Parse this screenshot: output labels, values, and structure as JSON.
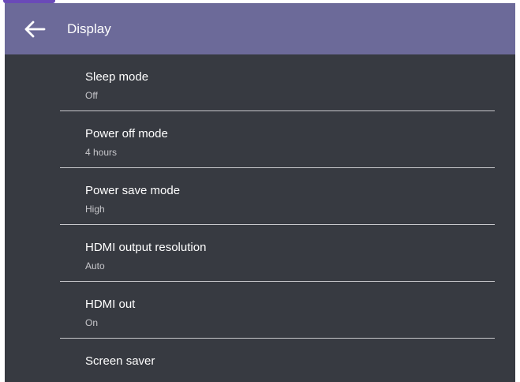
{
  "header": {
    "back_icon": "arrow-left-icon",
    "title": "Display"
  },
  "colors": {
    "header_bg": "#6c6a99",
    "panel_bg": "#373a41",
    "divider": "#c8c8cc",
    "primary_text": "#ffffff",
    "secondary_text": "#c7c7cb"
  },
  "settings": {
    "items": [
      {
        "label": "Sleep mode",
        "value": "Off"
      },
      {
        "label": "Power off mode",
        "value": "4 hours"
      },
      {
        "label": "Power save mode",
        "value": "High"
      },
      {
        "label": "HDMI output resolution",
        "value": "Auto"
      },
      {
        "label": "HDMI out",
        "value": "On"
      },
      {
        "label": "Screen saver",
        "value": ""
      }
    ]
  }
}
